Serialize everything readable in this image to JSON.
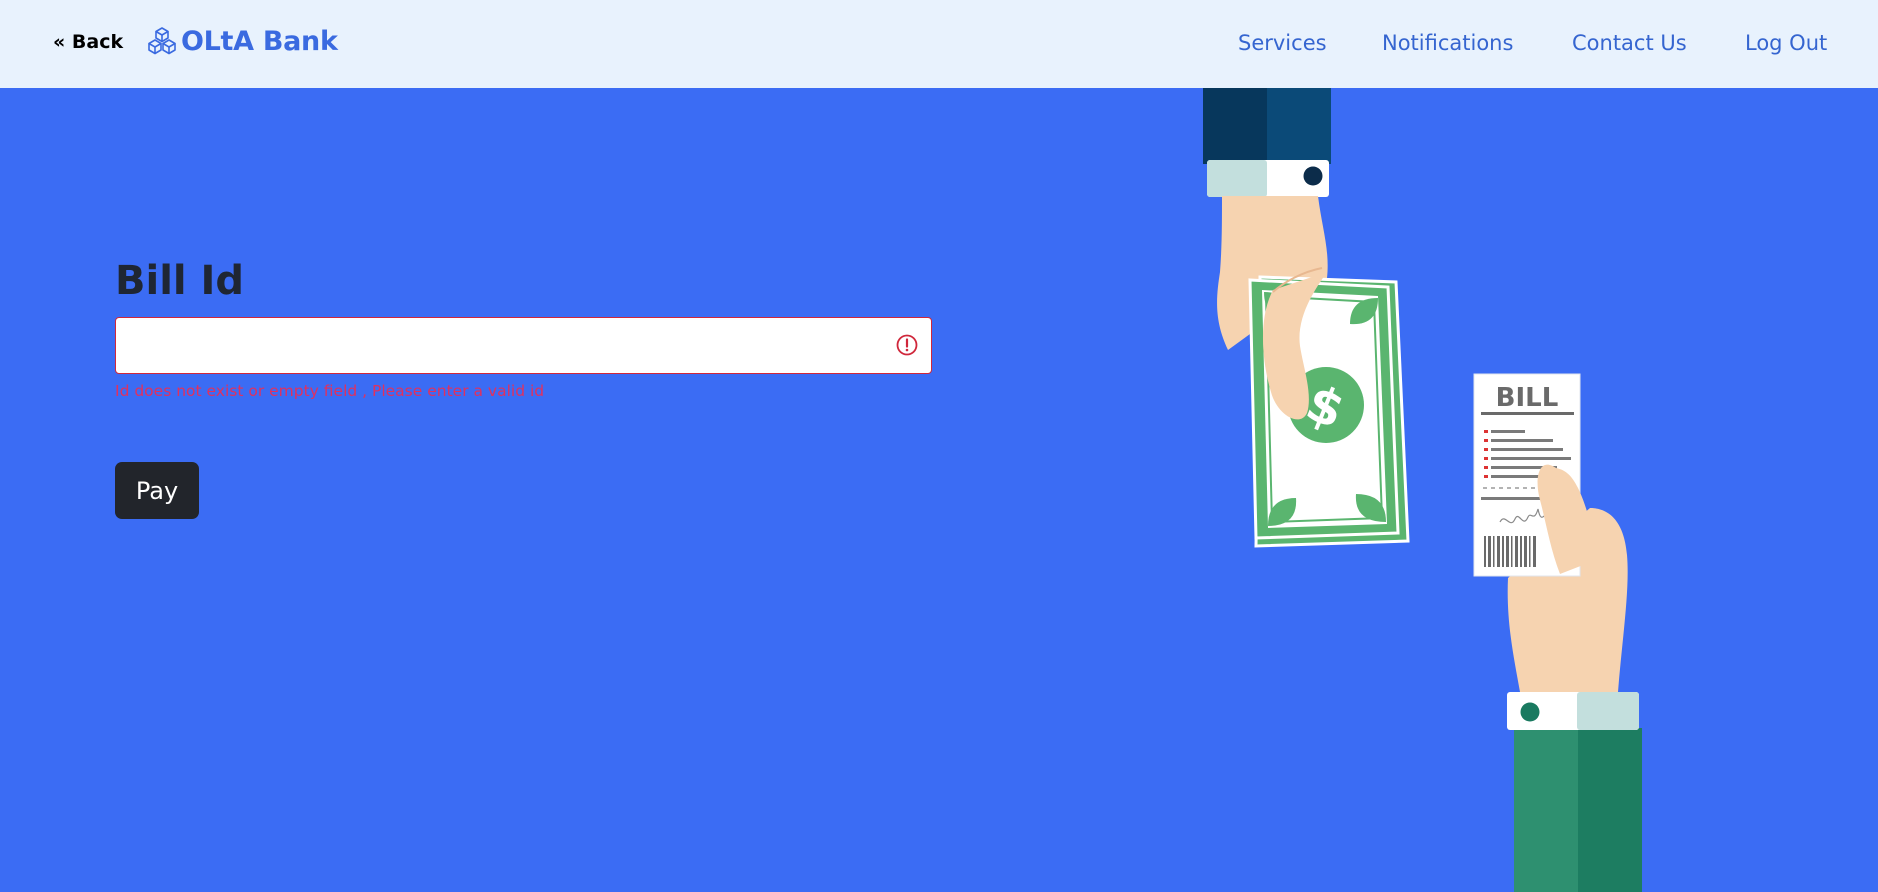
{
  "header": {
    "back_label": "« Back",
    "brand_name": "OLtA Bank",
    "brand_icon": "cubes-icon",
    "nav": {
      "services": "Services",
      "notifications": "Notifications",
      "contact": "Contact Us",
      "logout": "Log Out"
    }
  },
  "form": {
    "label": "Bill Id",
    "input_value": "",
    "input_placeholder": "",
    "error_message": "Id does not exist or empty field , Please enter a valid id",
    "error_icon": "exclamation-circle-icon",
    "submit_label": "Pay"
  },
  "illustration": {
    "bill_title": "BILL",
    "money_symbol": "$"
  },
  "colors": {
    "page_background": "#3b6cf4",
    "header_background": "#e8f2fd",
    "brand": "#3a6ae0",
    "nav_link": "#3565d0",
    "error": "#d0273b",
    "button": "#22252b",
    "money_green": "#5ab56f",
    "payer_sleeve": "#0b4a78",
    "payee_sleeve": "#2e9070"
  }
}
